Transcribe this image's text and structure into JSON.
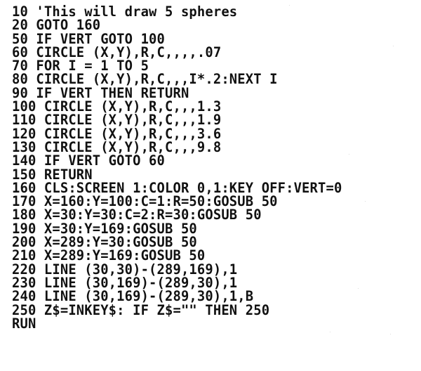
{
  "document": {
    "kind": "dot-matrix-printout",
    "language": "BASIC",
    "title": "BASIC program listing - draws 5 spheres",
    "background_color": "#ffffff",
    "text_color": "#111111"
  },
  "listing": {
    "lines": [
      "10 'This will draw 5 spheres",
      "20 GOTO 160",
      "50 IF VERT GOTO 100",
      "60 CIRCLE (X,Y),R,C,,,,.07",
      "70 FOR I = 1 TO 5",
      "80 CIRCLE (X,Y),R,C,,,I*.2:NEXT I",
      "90 IF VERT THEN RETURN",
      "100 CIRCLE (X,Y),R,C,,,1.3",
      "110 CIRCLE (X,Y),R,C,,,1.9",
      "120 CIRCLE (X,Y),R,C,,,3.6",
      "130 CIRCLE (X,Y),R,C,,,9.8",
      "140 IF VERT GOTO 60",
      "150 RETURN",
      "160 CLS:SCREEN 1:COLOR 0,1:KEY OFF:VERT=0",
      "170 X=160:Y=100:C=1:R=50:GOSUB 50",
      "180 X=30:Y=30:C=2:R=30:GOSUB 50",
      "190 X=30:Y=169:GOSUB 50",
      "200 X=289:Y=30:GOSUB 50",
      "210 X=289:Y=169:GOSUB 50",
      "220 LINE (30,30)-(289,169),1",
      "230 LINE (30,169)-(289,30),1",
      "240 LINE (30,169)-(289,30),1,B",
      "250 Z$=INKEY$: IF Z$=\"\" THEN 250",
      "RUN"
    ]
  }
}
